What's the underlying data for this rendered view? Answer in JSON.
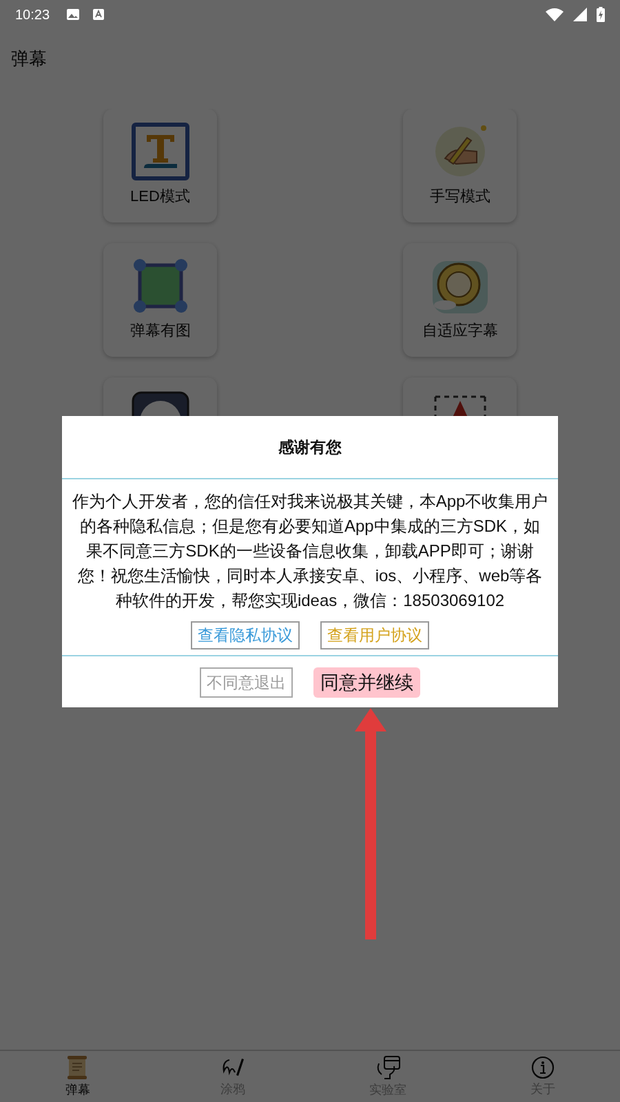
{
  "status_bar": {
    "time": "10:23"
  },
  "app_bar": {
    "title": "弹幕"
  },
  "cards": [
    {
      "kind": "led",
      "label": "LED模式"
    },
    {
      "kind": "handwriting",
      "label": "手写模式"
    },
    {
      "kind": "image",
      "label": "弹幕有图"
    },
    {
      "kind": "adaptive",
      "label": "自适应字幕"
    },
    {
      "kind": "clock"
    },
    {
      "kind": "arrow"
    }
  ],
  "dialog": {
    "title": "感谢有您",
    "body": "作为个人开发者，您的信任对我来说极其关键，本App不收集用户的各种隐私信息；但是您有必要知道App中集成的三方SDK，如果不同意三方SDK的一些设备信息收集，卸载APP即可；谢谢您！祝您生活愉快，同时本人承接安卓、ios、小程序、web等各种软件的开发，帮您实现ideas，微信：18503069102",
    "links": [
      {
        "label": "查看隐私协议",
        "color": "#3a9ad9"
      },
      {
        "label": "查看用户协议",
        "color": "#d4a21c"
      }
    ],
    "actions": [
      {
        "kind": "outline",
        "label": "不同意退出"
      },
      {
        "kind": "filled",
        "label": "同意并继续"
      }
    ]
  },
  "bottom_nav": [
    {
      "label": "弹幕",
      "selected": true
    },
    {
      "label": "涂鸦",
      "selected": false
    },
    {
      "label": "实验室",
      "selected": false
    },
    {
      "label": "关于",
      "selected": false
    }
  ]
}
